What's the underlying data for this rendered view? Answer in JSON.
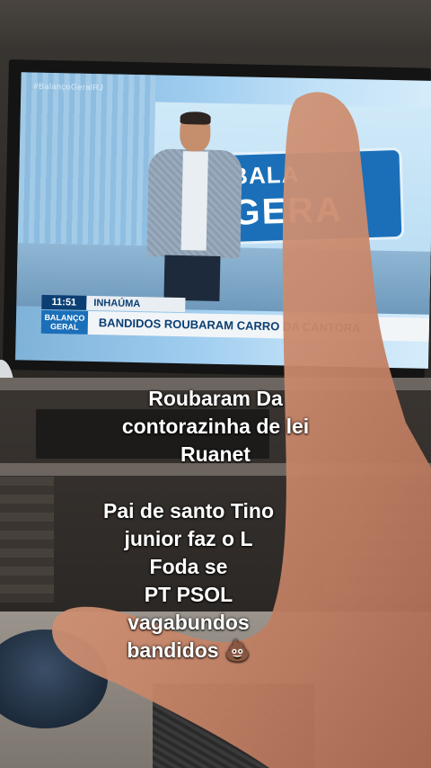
{
  "tv": {
    "watermark": "#BalançoGeralRJ",
    "set_logo_top": "BALA",
    "set_logo_bottom": "GERA",
    "lower_third": {
      "time": "11:51",
      "location": "INHAÚMA",
      "program_logo_top": "BALANÇO",
      "program_logo_bottom": "GERAL",
      "headline": "BANDIDOS ROUBARAM CARRO DA CANTORA"
    }
  },
  "caption_top": {
    "lines": [
      "Roubaram Da",
      "contorazinha de lei",
      "Ruanet"
    ]
  },
  "caption_bottom": {
    "lines": [
      "Pai de santo Tino",
      "junior faz o L",
      "Foda se",
      "PT PSOL",
      "vagabundos",
      "bandidos"
    ],
    "emoji": "💩"
  }
}
